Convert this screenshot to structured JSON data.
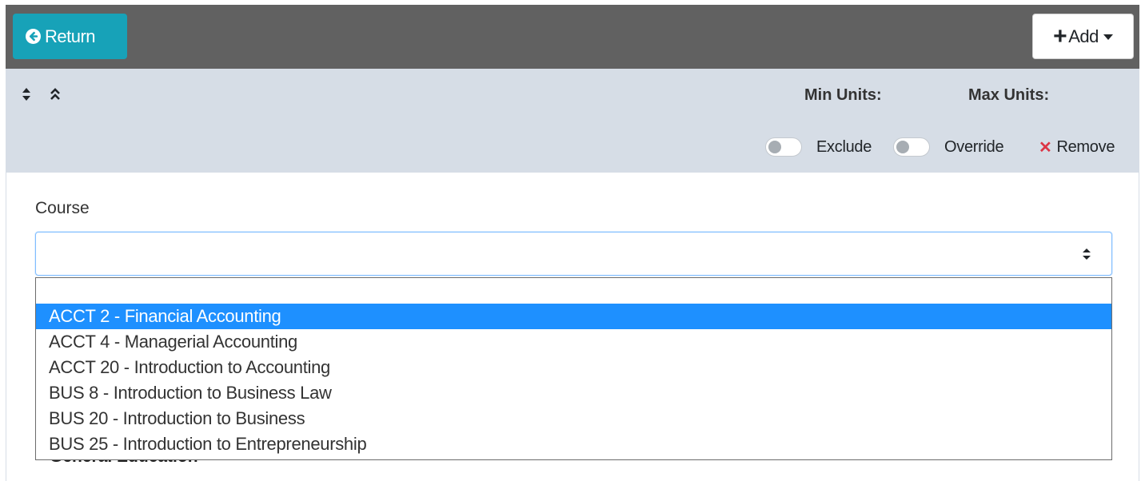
{
  "topbar": {
    "return_label": "Return",
    "add_label": "Add"
  },
  "rule_header": {
    "min_units_label": "Min Units:",
    "max_units_label": "Max Units:",
    "exclude_label": "Exclude",
    "override_label": "Override",
    "remove_label": "Remove"
  },
  "course": {
    "label": "Course",
    "value": "",
    "options": [
      "",
      "ACCT 2 - Financial Accounting",
      "ACCT 4 - Managerial Accounting",
      "ACCT 20 - Introduction to Accounting",
      "BUS 8 - Introduction to Business Law",
      "BUS 20 - Introduction to Business",
      "BUS 25 - Introduction to Entrepreneurship"
    ],
    "highlighted_option": "ACCT 2 - Financial Accounting"
  },
  "below": {
    "section_label": "General Education"
  },
  "colors": {
    "topbar_bg": "#616161",
    "return_button": "#17a2b8",
    "header_bg": "#d6dde6",
    "highlight": "#1e90ff",
    "remove_x": "#dc3545"
  }
}
